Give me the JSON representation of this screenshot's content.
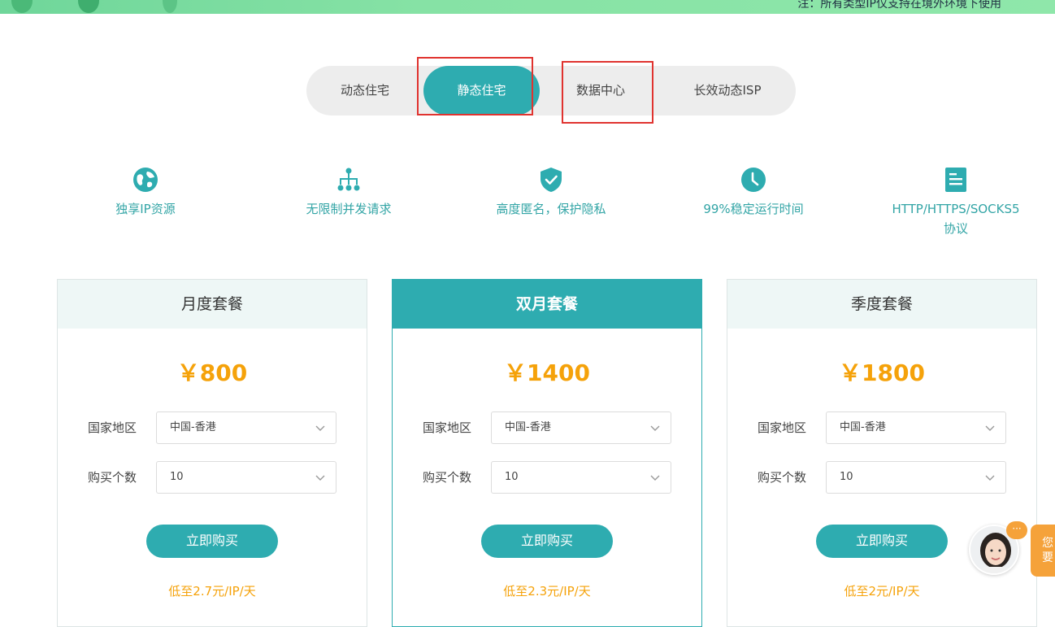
{
  "banner": {
    "note": "注：所有类型IP仅支持在境外环境下使用"
  },
  "tabs": [
    {
      "label": "动态住宅",
      "active": false
    },
    {
      "label": "静态住宅",
      "active": true
    },
    {
      "label": "数据中心",
      "active": false
    },
    {
      "label": "长效动态ISP",
      "active": false
    }
  ],
  "features": [
    {
      "icon": "globe-icon",
      "label": "独享IP资源"
    },
    {
      "icon": "network-icon",
      "label": "无限制并发请求"
    },
    {
      "icon": "shield-check-icon",
      "label": "高度匿名，保护隐私"
    },
    {
      "icon": "clock-icon",
      "label": "99%稳定运行时间"
    },
    {
      "icon": "document-icon",
      "label": "HTTP/HTTPS/SOCKS5",
      "label2": "协议"
    }
  ],
  "plans": [
    {
      "title": "月度套餐",
      "price": "￥800",
      "region_label": "国家地区",
      "region_value": "中国-香港",
      "qty_label": "购买个数",
      "qty_value": "10",
      "buy_label": "立即购买",
      "low_price": "低至2.7元/IP/天"
    },
    {
      "title": "双月套餐",
      "price": "￥1400",
      "region_label": "国家地区",
      "region_value": "中国-香港",
      "qty_label": "购买个数",
      "qty_value": "10",
      "buy_label": "立即购买",
      "low_price": "低至2.3元/IP/天"
    },
    {
      "title": "季度套餐",
      "price": "￥1800",
      "region_label": "国家地区",
      "region_value": "中国-香港",
      "qty_label": "购买个数",
      "qty_value": "10",
      "buy_label": "立即购买",
      "low_price": "低至2元/IP/天"
    }
  ],
  "chat": {
    "bubble": "···",
    "tag_line1": "您",
    "tag_line2": "要"
  },
  "colors": {
    "accent": "#2eacb0",
    "price": "#f5a20a",
    "highlight": "#e0332f",
    "chat": "#f5a23a"
  }
}
